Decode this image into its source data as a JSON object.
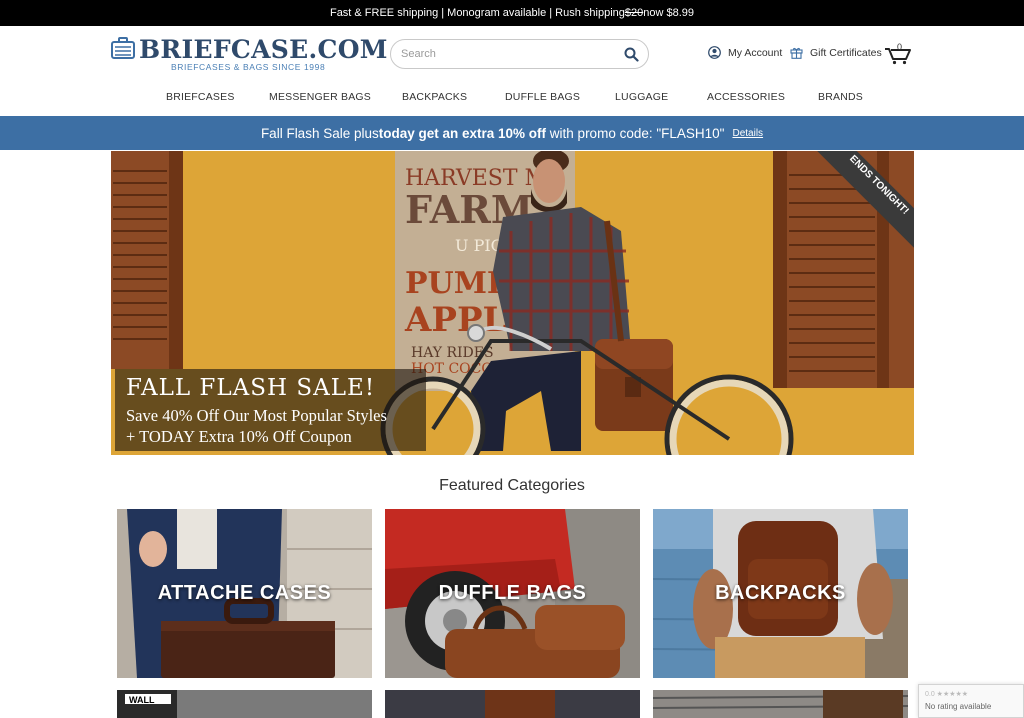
{
  "topbar": {
    "part1": "Fast & FREE shipping | Monogram available | Rush shipping ",
    "old_price": "$20",
    "part2": " now $8.99"
  },
  "header": {
    "logo_text": "BRIEFCASE.COM",
    "logo_tagline": "BRIEFCASES & BAGS SINCE 1998",
    "search_placeholder": "Search",
    "account_label": "My Account",
    "gift_label": "Gift Certificates",
    "cart_count": "0"
  },
  "nav": {
    "items": [
      "BRIEFCASES",
      "MESSENGER BAGS",
      "BACKPACKS",
      "DUFFLE BAGS",
      "LUGGAGE",
      "ACCESSORIES",
      "BRANDS"
    ]
  },
  "sale_bar": {
    "text1": "Fall Flash Sale plus ",
    "bold": "today get an extra 10% off",
    "text2": " with promo code: \"FLASH10\"",
    "details": "Details"
  },
  "hero": {
    "caption_title": "FALL FLASH SALE!",
    "caption_line1": "Save 40% Off Our Most Popular Styles",
    "caption_line2": "+ TODAY Extra 10% Off Coupon",
    "ribbon": "ENDS TONIGHT!",
    "sign_lines": [
      "HARVEST M",
      "FARM",
      "U PIC",
      "PUMP",
      "APPLE",
      "HAY RIDES",
      "HOT COCO"
    ]
  },
  "featured": {
    "title": "Featured Categories",
    "categories": [
      "ATTACHE CASES",
      "DUFFLE BAGS",
      "BACKPACKS"
    ],
    "street_sign": "WALL"
  },
  "recaptcha": {
    "stars": "0.0 ★★★★★",
    "text": "No rating available"
  },
  "colors": {
    "brand_blue": "#3d6fa4",
    "logo_navy": "#2f4a6b",
    "wall_yellow": "#e0a93a"
  }
}
